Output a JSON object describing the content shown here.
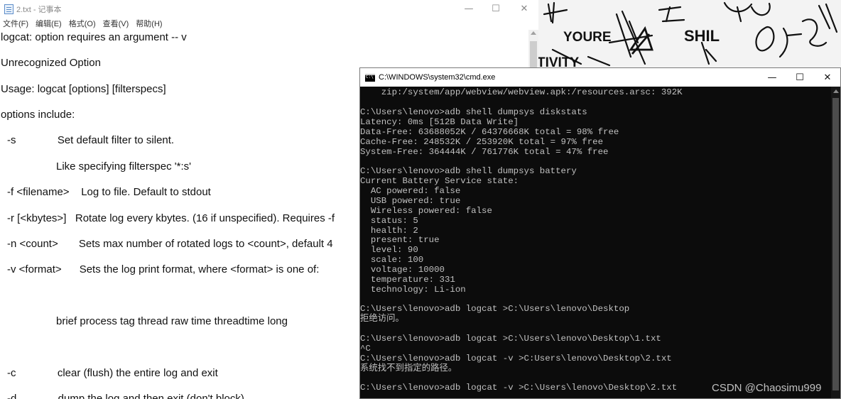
{
  "notepad": {
    "title": "2.txt - 记事本",
    "menu": [
      "文件(F)",
      "编辑(E)",
      "格式(O)",
      "查看(V)",
      "帮助(H)"
    ],
    "lines": [
      "logcat: option requires an argument -- v",
      "Unrecognized Option",
      "Usage: logcat [options] [filterspecs]",
      "options include:",
      "-s              Set default filter to silent.",
      "Like specifying filterspec '*:s'",
      "-f <filename>    Log to file. Default to stdout",
      "-r [<kbytes>]   Rotate log every kbytes. (16 if unspecified). Requires -f",
      "-n <count>       Sets max number of rotated logs to <count>, default 4",
      "-v <format>      Sets the log print format, where <format> is one of:",
      "brief process tag thread raw time threadtime long",
      "-c              clear (flush) the entire log and exit",
      "-d              dump the log and then exit (don't block)"
    ]
  },
  "wallpaper": {
    "words": [
      "YOURE",
      "SHIL",
      "TIVITY"
    ]
  },
  "cmd": {
    "title": "C:\\WINDOWS\\system32\\cmd.exe",
    "lines": [
      "    zip:/system/app/webview/webview.apk:/resources.arsc: 392K",
      "",
      "C:\\Users\\lenovo>adb shell dumpsys diskstats",
      "Latency: 0ms [512B Data Write]",
      "Data-Free: 63688052K / 64376668K total = 98% free",
      "Cache-Free: 248532K / 253920K total = 97% free",
      "System-Free: 364444K / 761776K total = 47% free",
      "",
      "C:\\Users\\lenovo>adb shell dumpsys battery",
      "Current Battery Service state:",
      "  AC powered: false",
      "  USB powered: true",
      "  Wireless powered: false",
      "  status: 5",
      "  health: 2",
      "  present: true",
      "  level: 90",
      "  scale: 100",
      "  voltage: 10000",
      "  temperature: 331",
      "  technology: Li-ion",
      "",
      "C:\\Users\\lenovo>adb logcat >C:\\Users\\lenovo\\Desktop",
      "拒绝访问。",
      "",
      "C:\\Users\\lenovo>adb logcat >C:\\Users\\lenovo\\Desktop\\1.txt",
      "^C",
      "C:\\Users\\lenovo>adb logcat -v >C:Users\\lenovo\\Desktop\\2.txt",
      "系统找不到指定的路径。",
      "",
      "C:\\Users\\lenovo>adb logcat -v >C:\\Users\\lenovo\\Desktop\\2.txt"
    ]
  },
  "watermark": "CSDN @Chaosimu999"
}
